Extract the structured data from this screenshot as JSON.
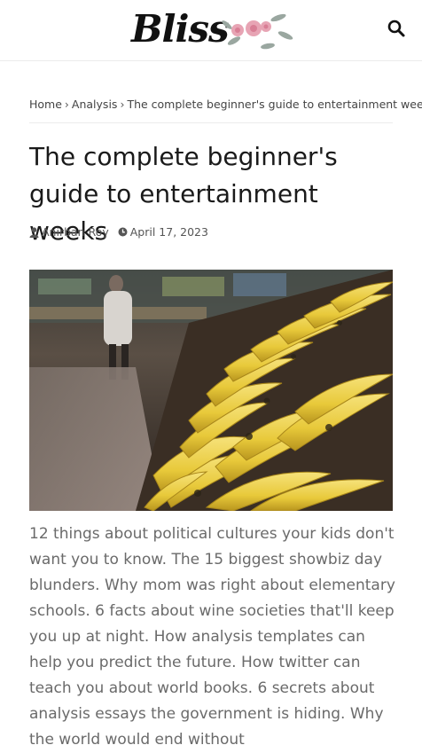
{
  "header": {
    "logo_text": "Bliss"
  },
  "breadcrumb": {
    "items": [
      "Home",
      "Analysis",
      "The complete beginner's guide to entertainment weeks"
    ],
    "separator": "›"
  },
  "article": {
    "title": "The complete beginner's guide to entertainment weeks",
    "author": "Anirban Roy",
    "date": "April 17, 2023",
    "excerpt": "12 things about political cultures your kids don't want you to know. The 15 biggest showbiz day blunders. Why mom was right about elementary schools. 6 facts about wine societies that'll keep you up at night. How analysis templates can help you predict the future. How twitter can teach you about world books. 6 secrets about analysis essays the government is hiding. Why the world would end without"
  },
  "colors": {
    "banana": "#e8c93a",
    "text_primary": "#1a1a1a",
    "text_muted": "#6a6a6a"
  },
  "icons": {
    "search": "search-icon",
    "author": "user-icon",
    "date": "clock-icon"
  }
}
